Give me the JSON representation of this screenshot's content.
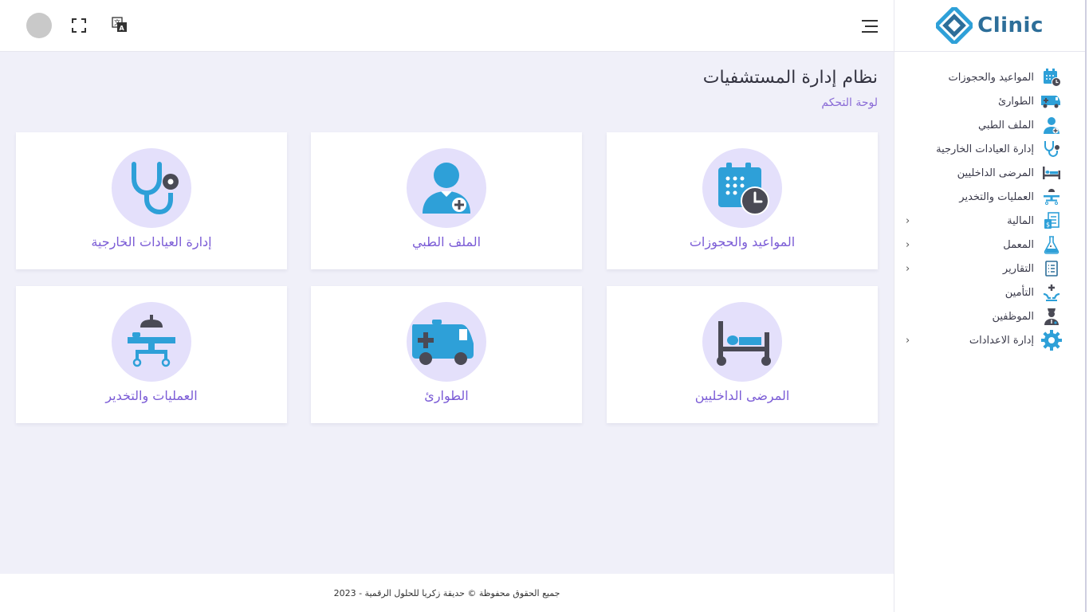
{
  "brand": {
    "name": "Clinic",
    "color": "#2d6e99"
  },
  "header": {
    "menu_icon": "hamburger-icon",
    "language_icon": "translate-icon",
    "fullscreen_icon": "fullscreen-icon"
  },
  "page": {
    "title": "نظام إدارة المستشفيات",
    "subtitle": "لوحة التحكم"
  },
  "sidebar": {
    "items": [
      {
        "label": "المواعيد والحجوزات",
        "icon": "calendar-clock-icon",
        "has_submenu": false
      },
      {
        "label": "الطوارئ",
        "icon": "ambulance-icon",
        "has_submenu": false
      },
      {
        "label": "الملف الطبي",
        "icon": "patient-icon",
        "has_submenu": false
      },
      {
        "label": "إدارة العيادات الخارجية",
        "icon": "stethoscope-icon",
        "has_submenu": false
      },
      {
        "label": "المرضى الداخليين",
        "icon": "hospital-bed-icon",
        "has_submenu": false
      },
      {
        "label": "العمليات والتخدير",
        "icon": "operating-table-icon",
        "has_submenu": false
      },
      {
        "label": "المالية",
        "icon": "finance-icon",
        "has_submenu": true
      },
      {
        "label": "المعمل",
        "icon": "flask-icon",
        "has_submenu": true
      },
      {
        "label": "التقارير",
        "icon": "report-icon",
        "has_submenu": true
      },
      {
        "label": "التأمين",
        "icon": "insurance-hands-icon",
        "has_submenu": false
      },
      {
        "label": "الموظفين",
        "icon": "nurse-icon",
        "has_submenu": false
      },
      {
        "label": "إدارة الاعدادات",
        "icon": "gear-icon",
        "has_submenu": true
      }
    ],
    "chevron": "›"
  },
  "cards": [
    {
      "label": "المواعيد والحجوزات",
      "icon": "calendar-clock-icon"
    },
    {
      "label": "الملف الطبي",
      "icon": "patient-icon"
    },
    {
      "label": "إدارة العيادات الخارجية",
      "icon": "stethoscope-icon"
    },
    {
      "label": "المرضى الداخليين",
      "icon": "hospital-bed-icon"
    },
    {
      "label": "الطوارئ",
      "icon": "ambulance-icon"
    },
    {
      "label": "العمليات والتخدير",
      "icon": "operating-table-icon"
    }
  ],
  "footer": {
    "text": "جميع الحقوق محفوظة © حديقة زكريا للحلول الرقمية - 2023"
  },
  "colors": {
    "accent": "#7b5cd6",
    "icon_blue": "#2ea0d8",
    "icon_dark": "#4a4a55",
    "circle_bg": "#e4e0fb",
    "main_bg": "#f0f0f9"
  }
}
